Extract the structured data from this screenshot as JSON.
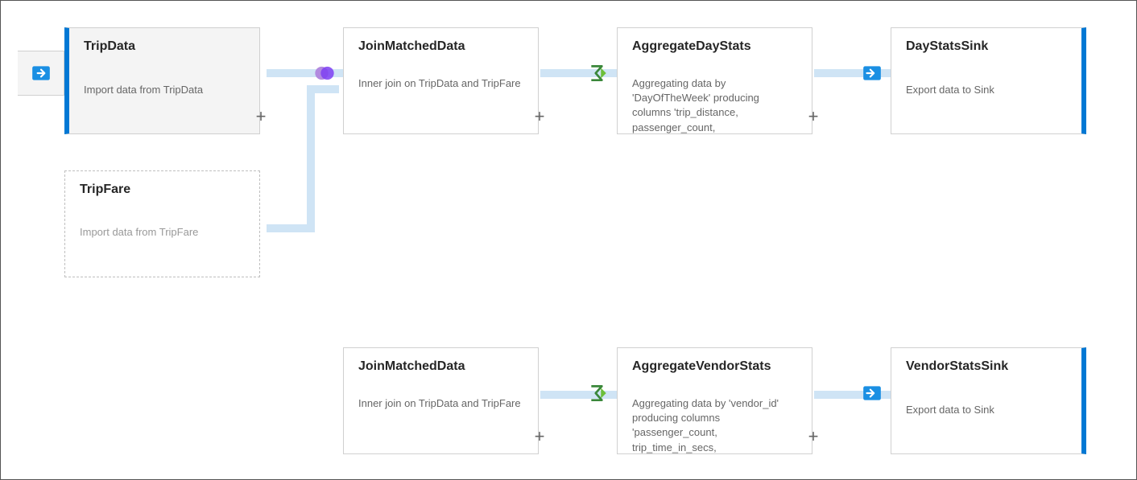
{
  "nodes": {
    "tripData": {
      "title": "TripData",
      "desc": "Import data from TripData"
    },
    "tripFare": {
      "title": "TripFare",
      "desc": "Import data from TripFare"
    },
    "joinTop": {
      "title": "JoinMatchedData",
      "desc": "Inner join on TripData and TripFare"
    },
    "aggDay": {
      "title": "AggregateDayStats",
      "desc": "Aggregating data by 'DayOfTheWeek' producing columns 'trip_distance, passenger_count,"
    },
    "daySink": {
      "title": "DayStatsSink",
      "desc": "Export data to Sink"
    },
    "joinBottom": {
      "title": "JoinMatchedData",
      "desc": "Inner join on TripData and TripFare"
    },
    "aggVendor": {
      "title": "AggregateVendorStats",
      "desc": "Aggregating data by 'vendor_id' producing columns 'passenger_count, trip_time_in_secs,"
    },
    "vendorSink": {
      "title": "VendorStatsSink",
      "desc": "Export data to Sink"
    }
  },
  "plus": "+"
}
